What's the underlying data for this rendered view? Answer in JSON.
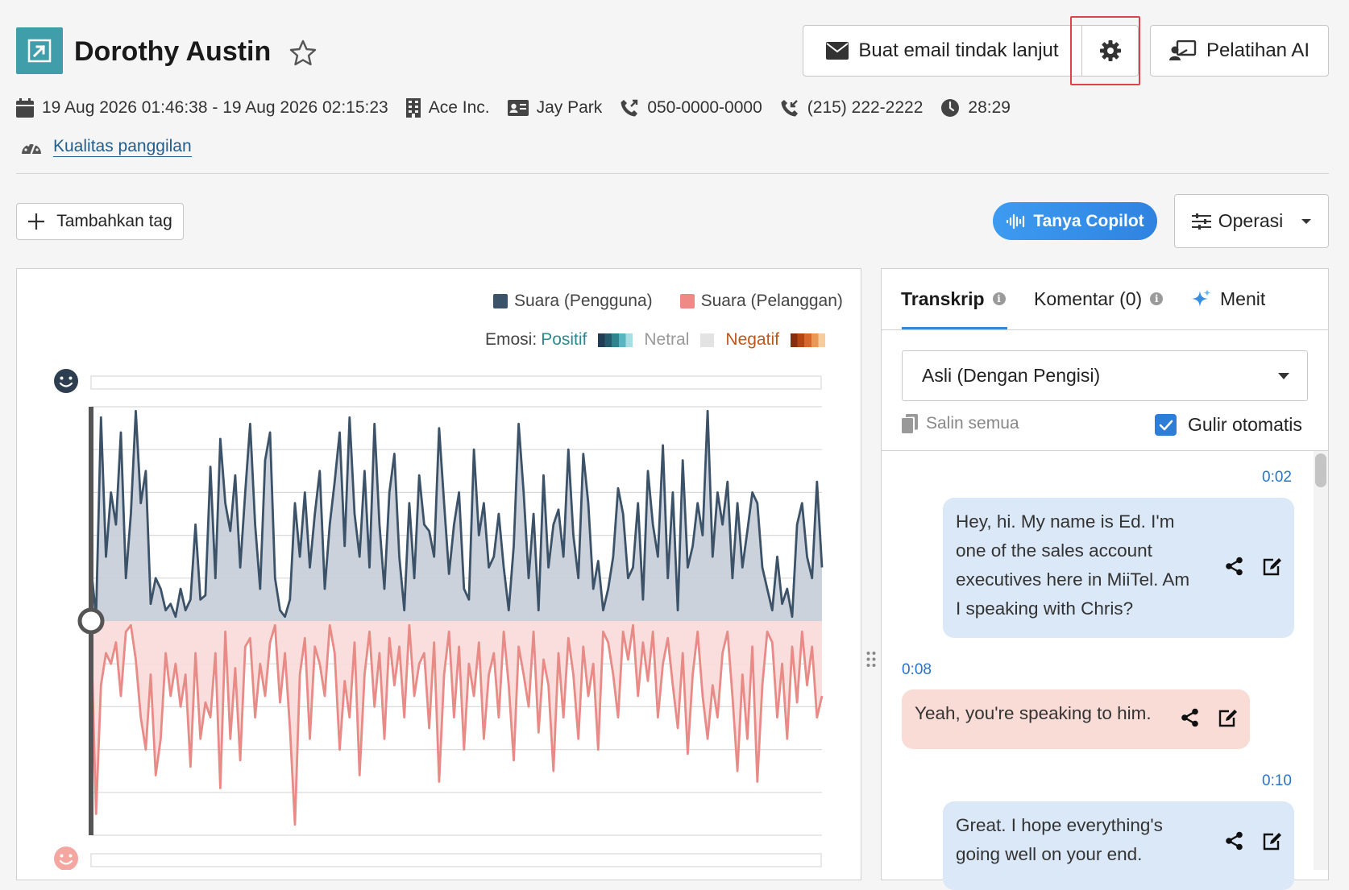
{
  "header": {
    "contact_name": "Dorothy Austin",
    "email_button_label": "Buat email tindak lanjut",
    "ai_button_label": "Pelatihan AI"
  },
  "meta": {
    "datetime_range": "19 Aug 2026 01:46:38 - 19 Aug 2026 02:15:23",
    "company": "Ace Inc.",
    "agent": "Jay Park",
    "outgoing_number": "050-0000-0000",
    "incoming_number": "(215) 222-2222",
    "duration": "28:29"
  },
  "call_quality_link": "Kualitas panggilan",
  "toolbar": {
    "add_tag_label": "Tambahkan tag",
    "copilot_label": "Tanya Copilot",
    "operations_label": "Operasi"
  },
  "chart": {
    "legend_user": "Suara (Pengguna)",
    "legend_customer": "Suara (Pelanggan)",
    "emotion_label": "Emosi:",
    "emotion_positive": "Positif",
    "emotion_neutral": "Netral",
    "emotion_negative": "Negatif",
    "colors": {
      "user_line": "#3b5268",
      "user_fill": "#c9d0d9",
      "customer_line": "#e88a86",
      "customer_fill": "#f9dcdb",
      "positive": "#2b8a8f",
      "negative": "#c0571a"
    }
  },
  "chart_data": {
    "type": "area",
    "series": [
      {
        "name": "Suara (Pengguna)",
        "values": [
          0.25,
          0.02,
          0.95,
          0.3,
          0.6,
          0.45,
          0.88,
          0.2,
          0.5,
          0.98,
          0.55,
          0.7,
          0.08,
          0.2,
          0.15,
          0.05,
          0.08,
          0.02,
          0.15,
          0.05,
          0.1,
          0.45,
          0.1,
          0.12,
          0.72,
          0.2,
          0.85,
          0.55,
          0.42,
          0.68,
          0.25,
          0.6,
          0.92,
          0.45,
          0.15,
          0.75,
          0.88,
          0.2,
          0.05,
          0.02,
          0.1,
          0.55,
          0.3,
          0.6,
          0.25,
          0.5,
          0.7,
          0.15,
          0.45,
          0.65,
          0.88,
          0.35,
          0.95,
          0.5,
          0.3,
          0.7,
          0.25,
          0.92,
          0.45,
          0.15,
          0.6,
          0.78,
          0.3,
          0.05,
          0.55,
          0.2,
          0.68,
          0.45,
          0.42,
          0.3,
          0.9,
          0.55,
          0.22,
          0.45,
          0.6,
          0.15,
          0.1,
          0.8,
          0.4,
          0.55,
          0.25,
          0.3,
          0.5,
          0.25,
          0.05,
          0.35,
          0.92,
          0.6,
          0.2,
          0.5,
          0.05,
          0.68,
          0.25,
          0.45,
          0.52,
          0.3,
          0.8,
          0.4,
          0.2,
          0.78,
          0.55,
          0.15,
          0.28,
          0.05,
          0.15,
          0.3,
          0.62,
          0.5,
          0.2,
          0.25,
          0.55,
          0.1,
          0.7,
          0.45,
          0.3,
          0.82,
          0.2,
          0.6,
          0.05,
          0.75,
          0.25,
          0.35,
          0.55,
          0.4,
          0.98,
          0.3,
          0.6,
          0.45,
          0.65,
          0.2,
          0.55,
          0.25,
          0.42,
          0.6,
          0.55,
          0.25,
          0.15,
          0.05,
          0.3,
          0.08,
          0.15,
          0.02,
          0.45,
          0.55,
          0.3,
          0.2,
          0.65,
          0.25
        ]
      },
      {
        "name": "Suara (Pelanggan)",
        "values": [
          0.05,
          0.9,
          0.3,
          0.15,
          0.2,
          0.1,
          0.35,
          0.05,
          0.02,
          0.18,
          0.45,
          0.6,
          0.25,
          0.72,
          0.55,
          0.15,
          0.35,
          0.2,
          0.4,
          0.25,
          0.68,
          0.15,
          0.55,
          0.38,
          0.45,
          0.15,
          0.78,
          0.05,
          0.55,
          0.22,
          0.65,
          0.12,
          0.08,
          0.45,
          0.2,
          0.35,
          0.1,
          0.02,
          0.38,
          0.15,
          0.5,
          0.95,
          0.25,
          0.08,
          0.55,
          0.12,
          0.2,
          0.35,
          0.02,
          0.15,
          0.6,
          0.28,
          0.45,
          0.1,
          0.72,
          0.25,
          0.05,
          0.4,
          0.15,
          0.55,
          0.08,
          0.3,
          0.12,
          0.45,
          0.02,
          0.35,
          0.2,
          0.15,
          0.5,
          0.1,
          0.75,
          0.25,
          0.05,
          0.45,
          0.12,
          0.6,
          0.2,
          0.35,
          0.1,
          0.55,
          0.25,
          0.15,
          0.45,
          0.05,
          0.3,
          0.65,
          0.12,
          0.25,
          0.4,
          0.05,
          0.52,
          0.18,
          0.3,
          0.7,
          0.15,
          0.45,
          0.08,
          0.25,
          0.55,
          0.12,
          0.35,
          0.2,
          0.6,
          0.05,
          0.1,
          0.25,
          0.45,
          0.05,
          0.18,
          0.02,
          0.35,
          0.1,
          0.28,
          0.05,
          0.45,
          0.2,
          0.08,
          0.3,
          0.5,
          0.15,
          0.62,
          0.25,
          0.05,
          0.35,
          0.55,
          0.3,
          0.45,
          0.15,
          0.05,
          0.35,
          0.7,
          0.25,
          0.55,
          0.12,
          0.75,
          0.3,
          0.05,
          0.1,
          0.45,
          0.2,
          0.55,
          0.12,
          0.38,
          0.05,
          0.3,
          0.12,
          0.45,
          0.35
        ]
      }
    ],
    "ylim": [
      -1,
      1
    ]
  },
  "transcript": {
    "tabs": [
      {
        "label": "Transkrip"
      },
      {
        "label": "Komentar (0)"
      },
      {
        "label": "Menit"
      }
    ],
    "select_value": "Asli (Dengan Pengisi)",
    "copy_all_label": "Salin semua",
    "autoscroll_label": "Gulir otomatis",
    "messages": [
      {
        "time": "0:02",
        "speaker": "user",
        "text": "Hey, hi. My name is Ed. I'm one of the sales account executives here in MiiTel. Am I speaking with Chris?"
      },
      {
        "time": "0:08",
        "speaker": "customer",
        "text": "Yeah, you're speaking to him."
      },
      {
        "time": "0:10",
        "speaker": "user",
        "text": "Great. I hope everything's going well on your end."
      }
    ]
  }
}
